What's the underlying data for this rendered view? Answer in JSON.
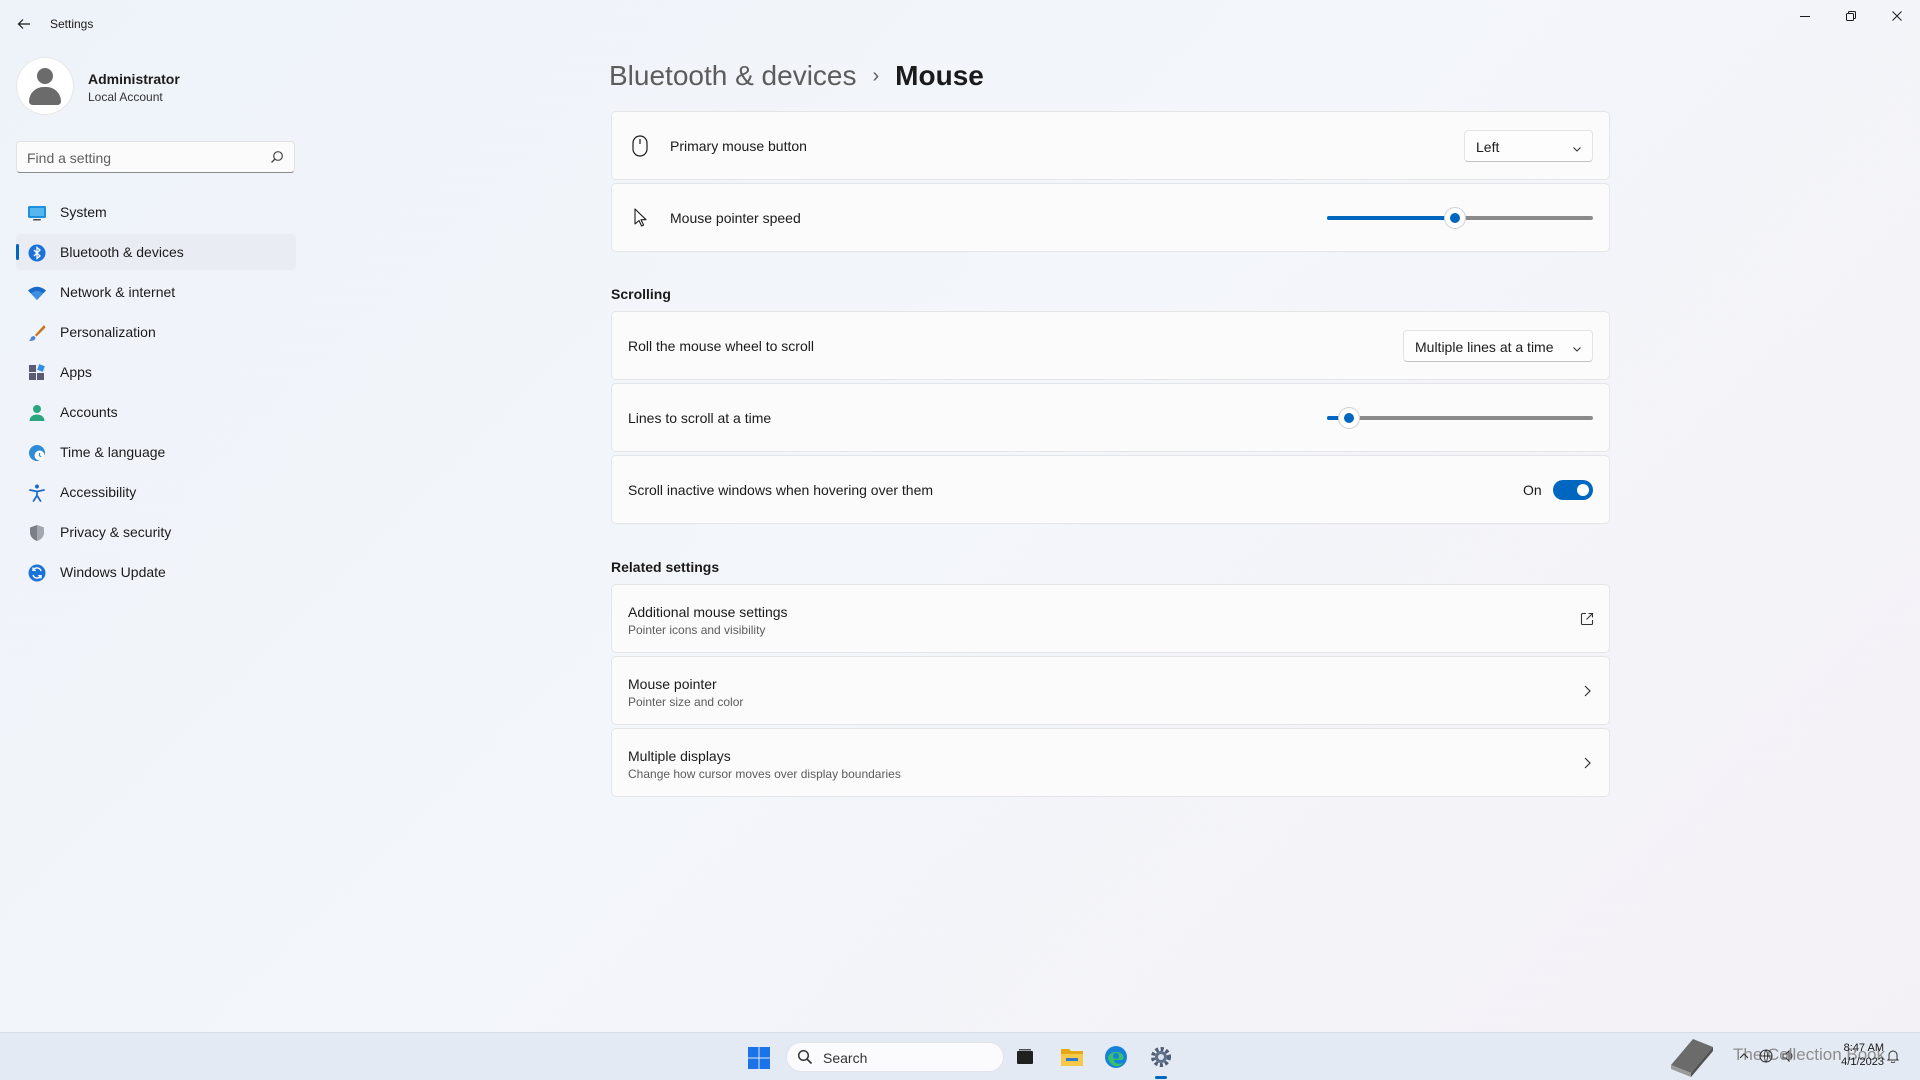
{
  "window": {
    "title": "Settings",
    "back_label": "Back",
    "minimize": "Minimize",
    "maximize": "Maximize",
    "close": "Close"
  },
  "user": {
    "name": "Administrator",
    "account_type": "Local Account"
  },
  "search": {
    "placeholder": "Find a setting"
  },
  "sidebar": {
    "items": [
      {
        "label": "System",
        "icon": "system-icon"
      },
      {
        "label": "Bluetooth & devices",
        "icon": "bluetooth-icon",
        "active": true
      },
      {
        "label": "Network & internet",
        "icon": "wifi-icon"
      },
      {
        "label": "Personalization",
        "icon": "brush-icon"
      },
      {
        "label": "Apps",
        "icon": "apps-icon"
      },
      {
        "label": "Accounts",
        "icon": "accounts-icon"
      },
      {
        "label": "Time & language",
        "icon": "globe-clock-icon"
      },
      {
        "label": "Accessibility",
        "icon": "accessibility-icon"
      },
      {
        "label": "Privacy & security",
        "icon": "shield-icon"
      },
      {
        "label": "Windows Update",
        "icon": "update-icon"
      }
    ]
  },
  "breadcrumb": {
    "parent": "Bluetooth & devices",
    "separator": "›",
    "current": "Mouse"
  },
  "settings": {
    "primary_button": {
      "label": "Primary mouse button",
      "value": "Left",
      "icon": "mouse-icon"
    },
    "pointer_speed": {
      "label": "Mouse pointer speed",
      "value_fraction": 0.48,
      "icon": "pointer-icon"
    }
  },
  "scrolling": {
    "title": "Scrolling",
    "wheel": {
      "label": "Roll the mouse wheel to scroll",
      "value": "Multiple lines at a time"
    },
    "lines": {
      "label": "Lines to scroll at a time",
      "value_fraction": 0.05
    },
    "inactive": {
      "label": "Scroll inactive windows when hovering over them",
      "state": "On",
      "enabled": true
    }
  },
  "related": {
    "title": "Related settings",
    "items": [
      {
        "label": "Additional mouse settings",
        "sub": "Pointer icons and visibility",
        "icon": "open-external-icon"
      },
      {
        "label": "Mouse pointer",
        "sub": "Pointer size and color",
        "icon": "chevron-right-icon"
      },
      {
        "label": "Multiple displays",
        "sub": "Change how cursor moves over display boundaries",
        "icon": "chevron-right-icon"
      }
    ]
  },
  "taskbar": {
    "search_label": "Search",
    "apps": [
      "start-icon",
      "task-view-icon",
      "file-explorer-icon",
      "edge-icon",
      "settings-icon"
    ],
    "watermark": "The Collection Book",
    "time": "8:47 AM",
    "date": "4/1/2023"
  },
  "colors": {
    "accent": "#0067c0",
    "card_bg": "#fbfbfb",
    "nav_active_bg": "#e9edf3"
  }
}
